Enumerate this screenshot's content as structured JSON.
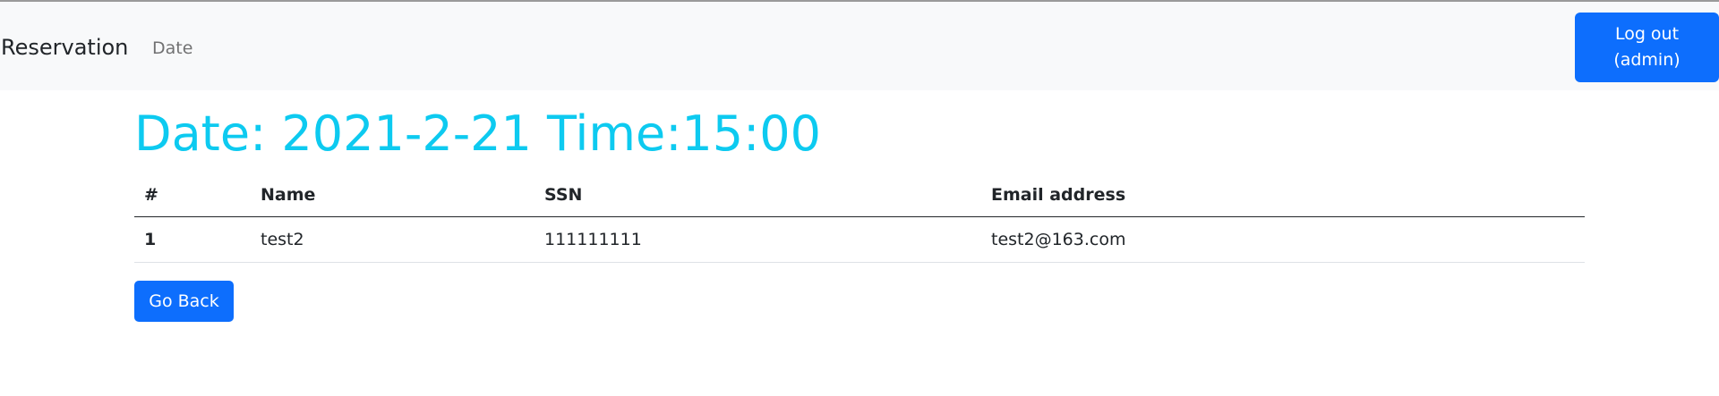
{
  "navbar": {
    "brand": "Reservation",
    "date_link": "Date",
    "logout_line1": "Log out",
    "logout_line2": "(admin)"
  },
  "heading": "Date: 2021-2-21 Time:15:00",
  "table": {
    "headers": [
      "#",
      "Name",
      "SSN",
      "Email address"
    ],
    "rows": [
      {
        "index": "1",
        "name": "test2",
        "ssn": "111111111",
        "email": "test2@163.com"
      }
    ]
  },
  "go_back_label": "Go Back",
  "colors": {
    "primary": "#0d6efd",
    "heading": "#0dcaf0",
    "navbar_bg": "#f8f9fa"
  }
}
